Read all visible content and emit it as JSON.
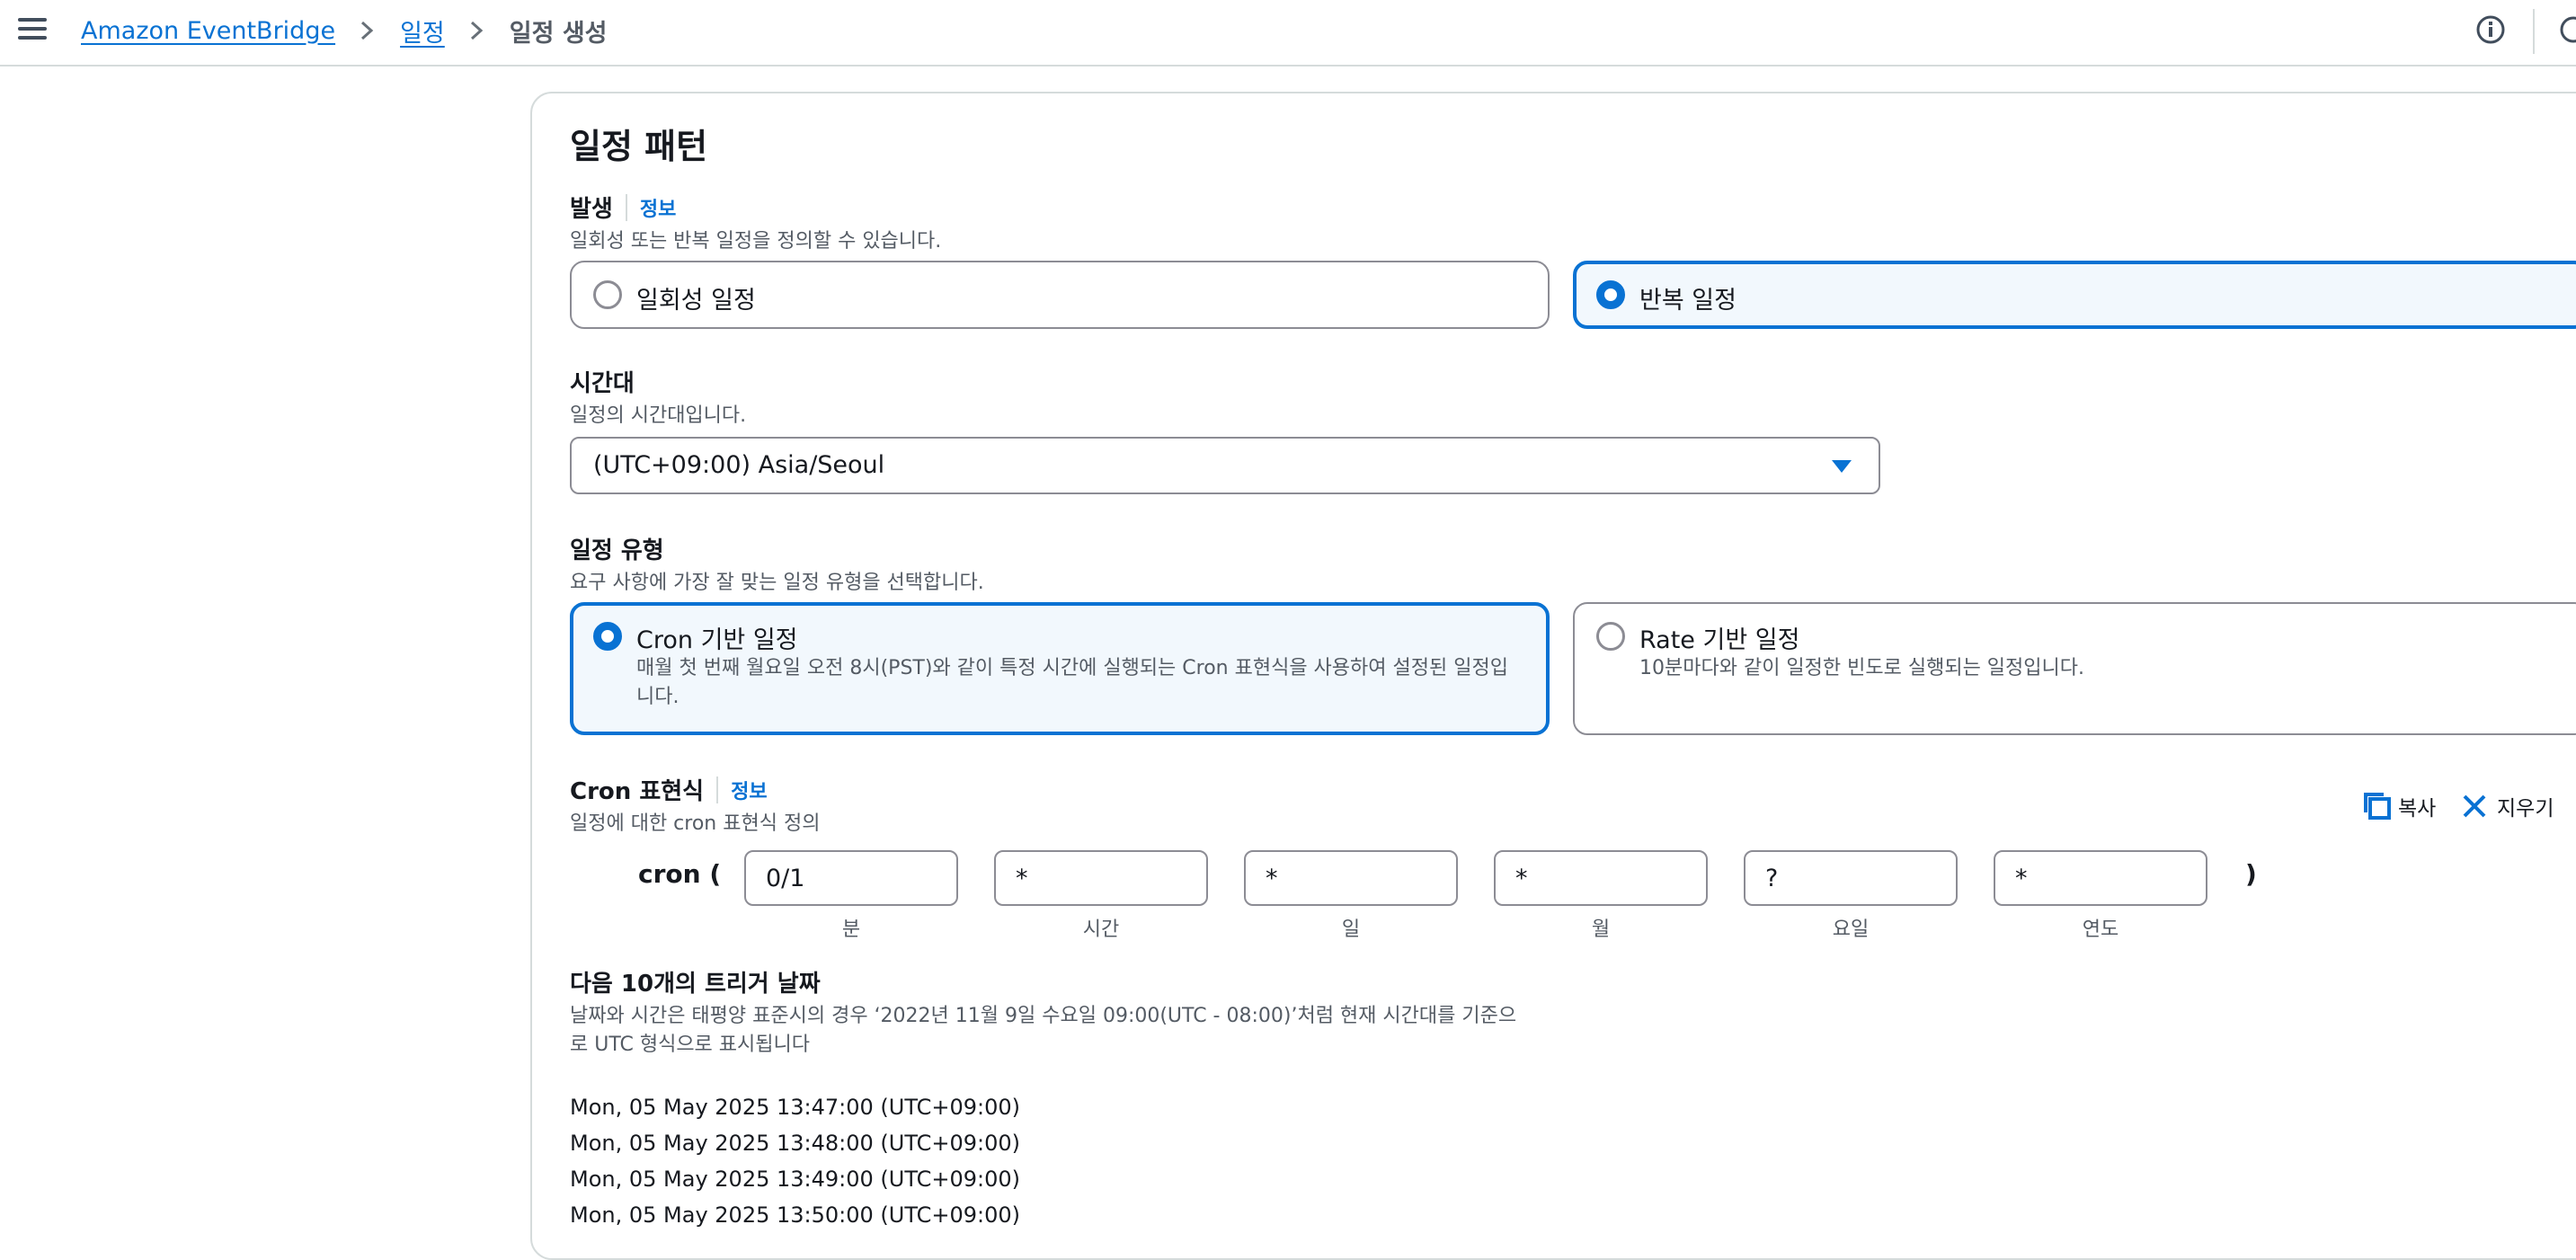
{
  "breadcrumb": {
    "items": [
      "Amazon EventBridge",
      "일정"
    ],
    "current": "일정 생성"
  },
  "card": {
    "title": "일정 패턴"
  },
  "occurrence": {
    "label": "발생",
    "info": "정보",
    "description": "일회성 또는 반복 일정을 정의할 수 있습니다.",
    "options": [
      "일회성 일정",
      "반복 일정"
    ],
    "selected": "반복 일정"
  },
  "timezone": {
    "label": "시간대",
    "description": "일정의 시간대입니다.",
    "value": "(UTC+09:00) Asia/Seoul"
  },
  "schedule_type": {
    "label": "일정 유형",
    "description": "요구 사항에 가장 잘 맞는 일정 유형을 선택합니다.",
    "cron": {
      "title": "Cron 기반 일정",
      "desc_line1": "매월 첫 번째 월요일 오전 8시(PST)와 같이 특정 시간에 실행되는 Cron 표현식을 사용하여 설정된 일정입",
      "desc_line2": "니다."
    },
    "rate": {
      "title": "Rate 기반 일정",
      "desc": "10분마다와 같이 일정한 빈도로 실행되는 일정입니다."
    },
    "selected": "Cron 기반 일정"
  },
  "cron": {
    "label": "Cron 표현식",
    "info": "정보",
    "description": "일정에 대한 cron 표현식 정의",
    "copy_label": "복사",
    "clear_label": "지우기",
    "prefix": "cron (",
    "suffix": ")",
    "fields": [
      {
        "value": "0/1",
        "caption": "분"
      },
      {
        "value": "*",
        "caption": "시간"
      },
      {
        "value": "*",
        "caption": "일"
      },
      {
        "value": "*",
        "caption": "월"
      },
      {
        "value": "?",
        "caption": "요일"
      },
      {
        "value": "*",
        "caption": "연도"
      }
    ]
  },
  "triggers": {
    "label": "다음 10개의 트리거 날짜",
    "desc_line1": "날짜와 시간은 태평양 표준시의 경우 ‘2022년 11월 9일 수요일 09:00(UTC - 08:00)’처럼 현재 시간대를 기준으",
    "desc_line2": "로 UTC 형식으로 표시됩니다",
    "dates": [
      "Mon, 05 May 2025 13:47:00 (UTC+09:00)",
      "Mon, 05 May 2025 13:48:00 (UTC+09:00)",
      "Mon, 05 May 2025 13:49:00 (UTC+09:00)",
      "Mon, 05 May 2025 13:50:00 (UTC+09:00)"
    ]
  },
  "colors": {
    "accent": "#0972d3",
    "text": "#16191f",
    "muted": "#545b64",
    "border": "#8c8c94"
  }
}
